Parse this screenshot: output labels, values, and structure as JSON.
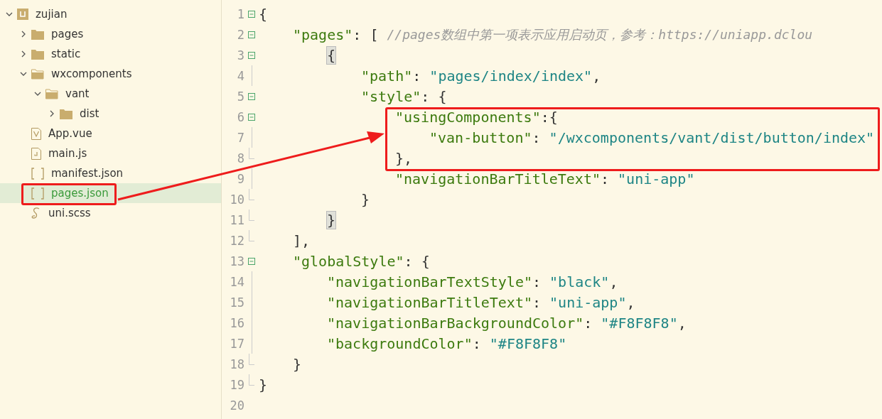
{
  "sidebar": {
    "items": [
      {
        "label": "zujian",
        "kind": "project",
        "expanded": true,
        "selected": false,
        "children": [
          {
            "label": "pages",
            "kind": "folder",
            "expanded": false,
            "selected": false
          },
          {
            "label": "static",
            "kind": "folder",
            "expanded": false,
            "selected": false
          },
          {
            "label": "wxcomponents",
            "kind": "folder",
            "expanded": true,
            "selected": false,
            "children": [
              {
                "label": "vant",
                "kind": "folder",
                "expanded": true,
                "selected": false,
                "children": [
                  {
                    "label": "dist",
                    "kind": "folder",
                    "expanded": false,
                    "selected": false
                  }
                ]
              }
            ]
          },
          {
            "label": "App.vue",
            "kind": "vue",
            "selected": false
          },
          {
            "label": "main.js",
            "kind": "js",
            "selected": false
          },
          {
            "label": "manifest.json",
            "kind": "json",
            "selected": false
          },
          {
            "label": "pages.json",
            "kind": "json",
            "selected": true
          },
          {
            "label": "uni.scss",
            "kind": "scss",
            "selected": false
          }
        ]
      }
    ]
  },
  "editor": {
    "lines": [
      {
        "number": "1",
        "foldable": true,
        "tokens": [
          {
            "text": "{",
            "kind": "punct"
          }
        ]
      },
      {
        "number": "2",
        "foldable": true,
        "tokens": [
          {
            "text": "\"pages\"",
            "kind": "key"
          },
          {
            "text": ": [ ",
            "kind": "punct"
          },
          {
            "text": "//pages数组中第一项表示应用启动页，参考：https://uniapp.dclou",
            "kind": "comment"
          }
        ]
      },
      {
        "number": "3",
        "foldable": true,
        "tokens": [
          {
            "text": "{",
            "kind": "punct",
            "matched": true
          }
        ]
      },
      {
        "number": "4",
        "foldable": false,
        "tokens": [
          {
            "text": "\"path\"",
            "kind": "key"
          },
          {
            "text": ": ",
            "kind": "punct"
          },
          {
            "text": "\"pages/index/index\"",
            "kind": "string"
          },
          {
            "text": ",",
            "kind": "punct"
          }
        ]
      },
      {
        "number": "5",
        "foldable": true,
        "tokens": [
          {
            "text": "\"style\"",
            "kind": "key"
          },
          {
            "text": ": {",
            "kind": "punct"
          }
        ]
      },
      {
        "number": "6",
        "foldable": true,
        "tokens": [
          {
            "text": "\"usingComponents\"",
            "kind": "key"
          },
          {
            "text": ":{",
            "kind": "punct"
          }
        ]
      },
      {
        "number": "7",
        "foldable": false,
        "tokens": [
          {
            "text": "\"van-button\"",
            "kind": "key"
          },
          {
            "text": ": ",
            "kind": "punct"
          },
          {
            "text": "\"/wxcomponents/vant/dist/button/index\"",
            "kind": "string"
          }
        ]
      },
      {
        "number": "8",
        "foldable": false,
        "tokens": [
          {
            "text": "},",
            "kind": "punct"
          }
        ]
      },
      {
        "number": "9",
        "foldable": false,
        "tokens": [
          {
            "text": "\"navigationBarTitleText\"",
            "kind": "key"
          },
          {
            "text": ": ",
            "kind": "punct"
          },
          {
            "text": "\"uni-app\"",
            "kind": "string"
          }
        ]
      },
      {
        "number": "10",
        "foldable": false,
        "tokens": [
          {
            "text": "}",
            "kind": "punct"
          }
        ]
      },
      {
        "number": "11",
        "foldable": false,
        "tokens": [
          {
            "text": "}",
            "kind": "punct",
            "matched": true
          }
        ]
      },
      {
        "number": "12",
        "foldable": false,
        "tokens": [
          {
            "text": "],",
            "kind": "punct"
          }
        ]
      },
      {
        "number": "13",
        "foldable": true,
        "tokens": [
          {
            "text": "\"globalStyle\"",
            "kind": "key"
          },
          {
            "text": ": {",
            "kind": "punct"
          }
        ]
      },
      {
        "number": "14",
        "foldable": false,
        "tokens": [
          {
            "text": "\"navigationBarTextStyle\"",
            "kind": "key"
          },
          {
            "text": ": ",
            "kind": "punct"
          },
          {
            "text": "\"black\"",
            "kind": "string"
          },
          {
            "text": ",",
            "kind": "punct"
          }
        ]
      },
      {
        "number": "15",
        "foldable": false,
        "tokens": [
          {
            "text": "\"navigationBarTitleText\"",
            "kind": "key"
          },
          {
            "text": ": ",
            "kind": "punct"
          },
          {
            "text": "\"uni-app\"",
            "kind": "string"
          },
          {
            "text": ",",
            "kind": "punct"
          }
        ]
      },
      {
        "number": "16",
        "foldable": false,
        "tokens": [
          {
            "text": "\"navigationBarBackgroundColor\"",
            "kind": "key"
          },
          {
            "text": ": ",
            "kind": "punct"
          },
          {
            "text": "\"#F8F8F8\"",
            "kind": "string"
          },
          {
            "text": ",",
            "kind": "punct"
          }
        ]
      },
      {
        "number": "17",
        "foldable": false,
        "tokens": [
          {
            "text": "\"backgroundColor\"",
            "kind": "key"
          },
          {
            "text": ": ",
            "kind": "punct"
          },
          {
            "text": "\"#F8F8F8\"",
            "kind": "string"
          }
        ]
      },
      {
        "number": "18",
        "foldable": false,
        "tokens": [
          {
            "text": "}",
            "kind": "punct"
          }
        ]
      },
      {
        "number": "19",
        "foldable": false,
        "tokens": [
          {
            "text": "}",
            "kind": "punct"
          }
        ]
      },
      {
        "number": "20",
        "foldable": false
      }
    ]
  }
}
